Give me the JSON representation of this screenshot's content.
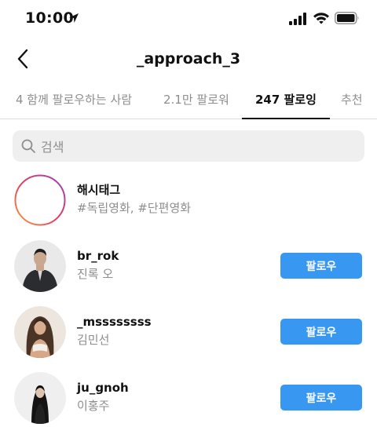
{
  "status_bar": {
    "time": "10:00"
  },
  "header": {
    "title": "_approach_3"
  },
  "tabs": [
    {
      "label": "4 함께 팔로우하는 사람",
      "active": false
    },
    {
      "label": "2.1만 팔로워",
      "active": false
    },
    {
      "label": "247 팔로잉",
      "active": true
    },
    {
      "label": "추천",
      "active": false
    }
  ],
  "search": {
    "placeholder": "검색"
  },
  "items": [
    {
      "username": "해시태그",
      "subtitle": "#독립영화, #단편영화"
    },
    {
      "username": "br_rok",
      "subtitle": "진록 오",
      "button": "팔로우"
    },
    {
      "username": "_mssssssss",
      "subtitle": "김민선",
      "button": "팔로우"
    },
    {
      "username": "ju_gnoh",
      "subtitle": "이홍주",
      "button": "팔로우"
    }
  ],
  "colors": {
    "follow_button": "#3897f0",
    "muted_text": "#8e8e8e"
  }
}
